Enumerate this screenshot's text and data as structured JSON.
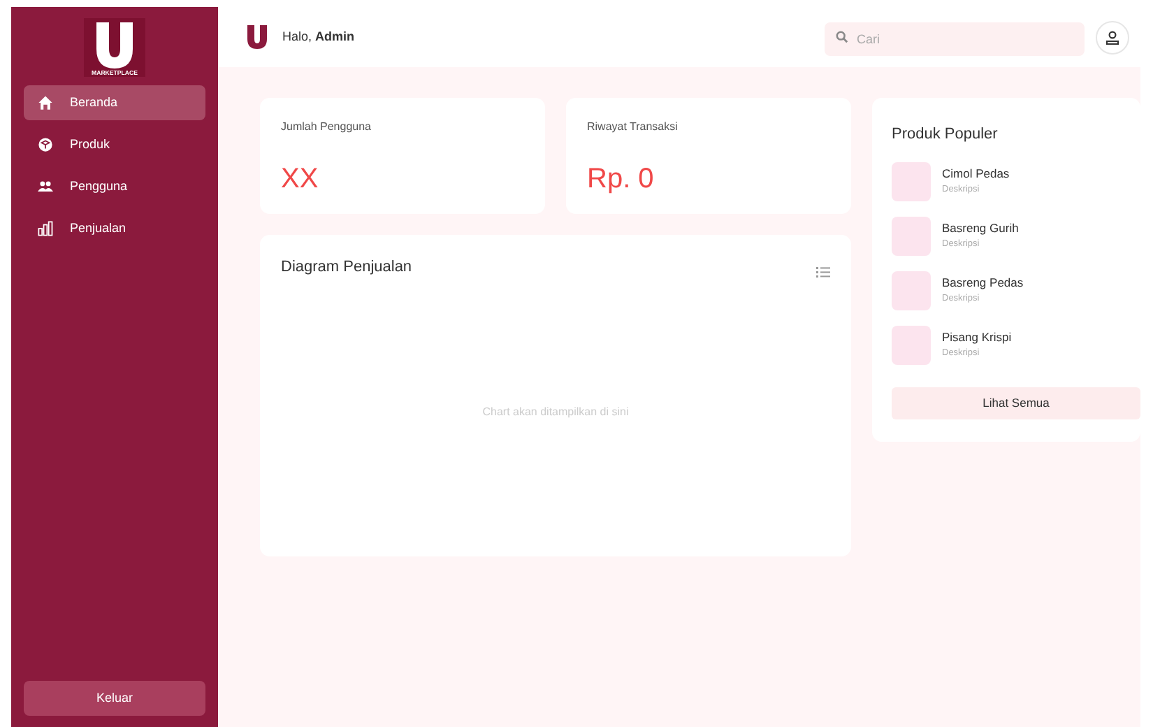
{
  "sidebar": {
    "logo_text": "MARKETPLACE",
    "items": [
      {
        "label": "Beranda",
        "selected": true
      },
      {
        "label": "Produk",
        "selected": false
      },
      {
        "label": "Pengguna",
        "selected": false
      },
      {
        "label": "Penjualan",
        "selected": false
      }
    ],
    "logout": "Keluar"
  },
  "header": {
    "greeting": "Halo, **Admin**",
    "search": {
      "placeholder": "Cari"
    }
  },
  "stats": [
    {
      "label": "Jumlah Pengguna",
      "value": "XX"
    },
    {
      "label": "Riwayat Transaksi",
      "value": "Rp. 0"
    }
  ],
  "chart_panel": {
    "title": "Diagram Penjualan",
    "placeholder": "Chart akan ditampilkan di sini"
  },
  "popular": {
    "title": "Produk Populer",
    "items": [
      {
        "name": "Cimol Pedas",
        "description": "Deskripsi"
      },
      {
        "name": "Basreng Gurih",
        "description": "Deskripsi"
      },
      {
        "name": "Basreng Pedas",
        "description": "Deskripsi"
      },
      {
        "name": "Pisang Krispi",
        "description": "Deskripsi"
      }
    ],
    "button": "Lihat Semua"
  }
}
